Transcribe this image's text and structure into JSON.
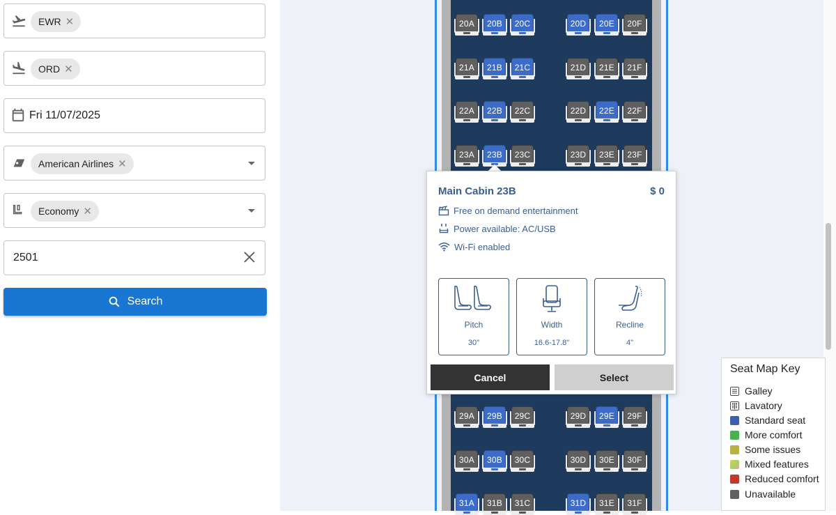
{
  "form": {
    "origin": {
      "chip": "EWR"
    },
    "destination": {
      "chip": "ORD"
    },
    "date": {
      "value": "Fri 11/07/2025"
    },
    "airline": {
      "chip": "American Airlines"
    },
    "cabin": {
      "chip": "Economy"
    },
    "flight_number": {
      "value": "2501"
    },
    "search_label": "Search"
  },
  "seatmap": {
    "rows": [
      {
        "seats": [
          {
            "label": "20A",
            "type": "unavailable"
          },
          {
            "label": "20B",
            "type": "standard"
          },
          {
            "label": "20C",
            "type": "standard"
          },
          {
            "label": "20D",
            "type": "standard"
          },
          {
            "label": "20E",
            "type": "standard"
          },
          {
            "label": "20F",
            "type": "unavailable"
          }
        ]
      },
      {
        "seats": [
          {
            "label": "21A",
            "type": "unavailable"
          },
          {
            "label": "21B",
            "type": "standard"
          },
          {
            "label": "21C",
            "type": "standard"
          },
          {
            "label": "21D",
            "type": "unavailable"
          },
          {
            "label": "21E",
            "type": "unavailable"
          },
          {
            "label": "21F",
            "type": "unavailable"
          }
        ]
      },
      {
        "seats": [
          {
            "label": "22A",
            "type": "unavailable"
          },
          {
            "label": "22B",
            "type": "standard"
          },
          {
            "label": "22C",
            "type": "unavailable"
          },
          {
            "label": "22D",
            "type": "unavailable"
          },
          {
            "label": "22E",
            "type": "standard"
          },
          {
            "label": "22F",
            "type": "unavailable"
          }
        ]
      },
      {
        "seats": [
          {
            "label": "23A",
            "type": "unavailable"
          },
          {
            "label": "23B",
            "type": "standard"
          },
          {
            "label": "23C",
            "type": "unavailable"
          },
          {
            "label": "23D",
            "type": "unavailable"
          },
          {
            "label": "23E",
            "type": "unavailable"
          },
          {
            "label": "23F",
            "type": "unavailable"
          }
        ]
      },
      {
        "seats": [
          {
            "label": "29A",
            "type": "unavailable"
          },
          {
            "label": "29B",
            "type": "standard"
          },
          {
            "label": "29C",
            "type": "unavailable"
          },
          {
            "label": "29D",
            "type": "unavailable"
          },
          {
            "label": "29E",
            "type": "standard"
          },
          {
            "label": "29F",
            "type": "unavailable"
          }
        ]
      },
      {
        "seats": [
          {
            "label": "30A",
            "type": "unavailable"
          },
          {
            "label": "30B",
            "type": "standard"
          },
          {
            "label": "30C",
            "type": "unavailable"
          },
          {
            "label": "30D",
            "type": "unavailable"
          },
          {
            "label": "30E",
            "type": "unavailable"
          },
          {
            "label": "30F",
            "type": "unavailable"
          }
        ]
      },
      {
        "seats": [
          {
            "label": "31A",
            "type": "standard"
          },
          {
            "label": "31B",
            "type": "unavailable"
          },
          {
            "label": "31C",
            "type": "unavailable"
          },
          {
            "label": "31D",
            "type": "standard"
          },
          {
            "label": "31E",
            "type": "unavailable"
          },
          {
            "label": "31F",
            "type": "unavailable"
          }
        ]
      }
    ]
  },
  "popover": {
    "title": "Main Cabin 23B",
    "price": "$ 0",
    "features": [
      "Free on demand entertainment",
      "Power available: AC/USB",
      "Wi-Fi enabled"
    ],
    "cards": [
      {
        "label": "Pitch",
        "value": "30\""
      },
      {
        "label": "Width",
        "value": "16.6-17.8\""
      },
      {
        "label": "Recline",
        "value": "4\""
      }
    ],
    "cancel_label": "Cancel",
    "select_label": "Select"
  },
  "legend": {
    "title": "Seat Map Key",
    "items": [
      {
        "label": "Galley",
        "color": ""
      },
      {
        "label": "Lavatory",
        "color": ""
      },
      {
        "label": "Standard seat",
        "color": "#3c5fb2"
      },
      {
        "label": "More comfort",
        "color": "#4caf50"
      },
      {
        "label": "Some issues",
        "color": "#b7b146"
      },
      {
        "label": "Mixed features",
        "color": "mixed"
      },
      {
        "label": "Reduced comfort",
        "color": "#c0392b"
      },
      {
        "label": "Unavailable",
        "color": "#616161"
      }
    ]
  }
}
